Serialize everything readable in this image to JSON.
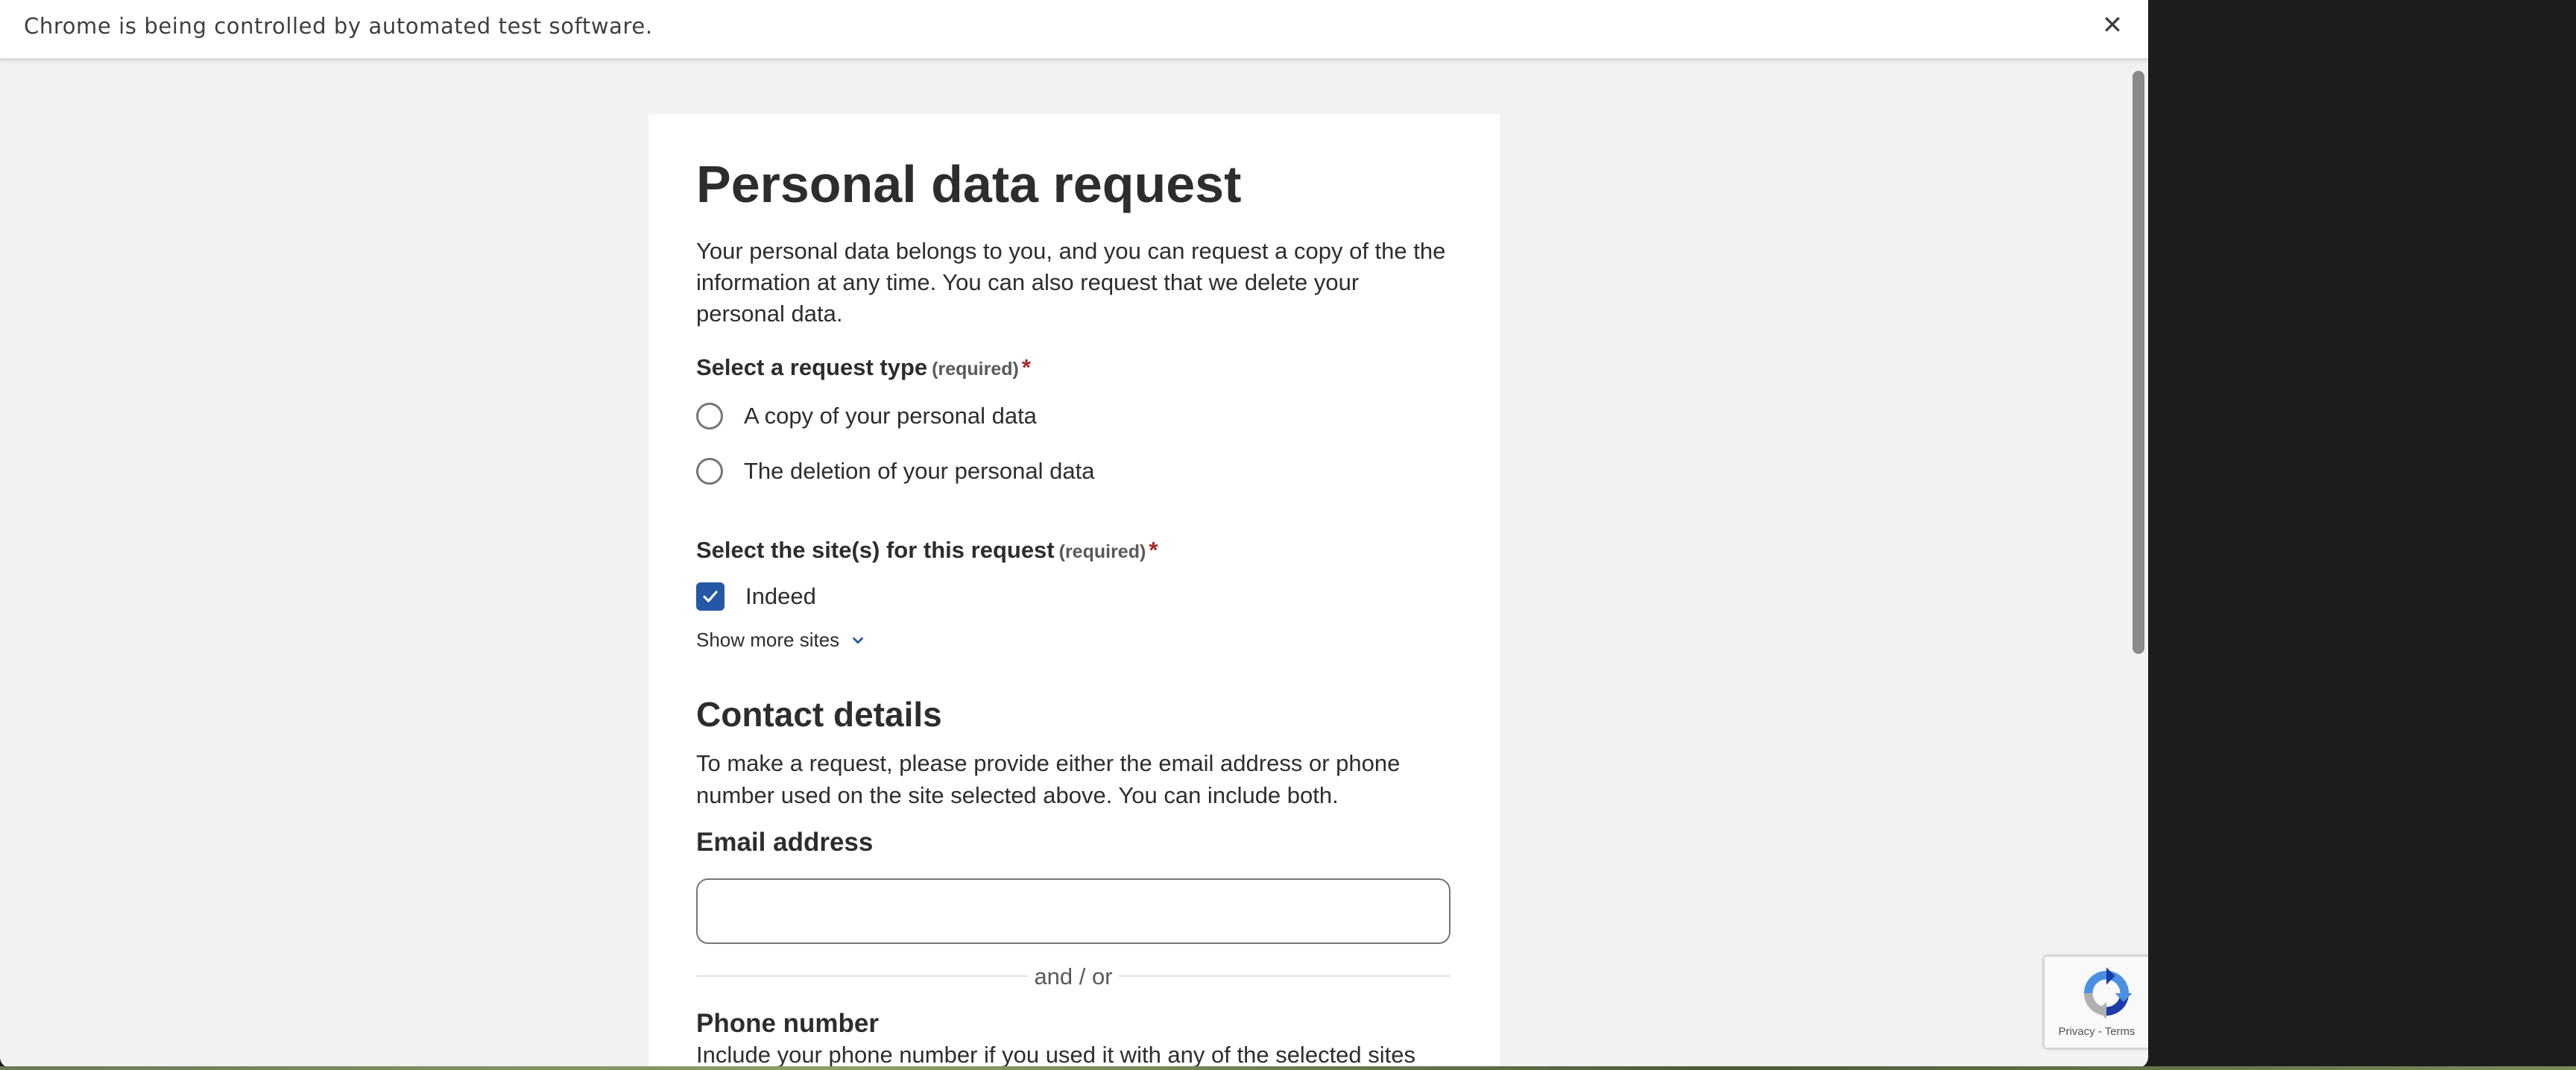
{
  "infobar": {
    "message": "Chrome is being controlled by automated test software.",
    "close_icon": "close-icon"
  },
  "form": {
    "title": "Personal data request",
    "intro": "Your personal data belongs to you, and you can request a copy of the the information at any time. You can also request that we delete your personal data.",
    "request_type": {
      "label": "Select a request type",
      "required_tag": "(required)",
      "required_mark": "*",
      "options": [
        {
          "label": "A copy of your personal data",
          "selected": false
        },
        {
          "label": "The deletion of your personal data",
          "selected": false
        }
      ]
    },
    "sites": {
      "label": "Select the site(s) for this request",
      "required_tag": "(required)",
      "required_mark": "*",
      "options": [
        {
          "label": "Indeed",
          "checked": true
        }
      ],
      "show_more": "Show more sites"
    },
    "contact": {
      "title": "Contact details",
      "description": "To make a request, please provide either the email address or phone number used on the site selected above. You can include both.",
      "email_label": "Email address",
      "email_value": "",
      "separator": "and / or",
      "phone_label": "Phone number",
      "phone_help": "Include your phone number if you used it with any of the selected sites"
    }
  },
  "recaptcha": {
    "privacy": "Privacy",
    "separator": "-",
    "terms": "Terms"
  },
  "colors": {
    "accent": "#2557a7",
    "required": "#a9252b",
    "text": "#2d2d2d",
    "background": "#f3f2f1"
  }
}
